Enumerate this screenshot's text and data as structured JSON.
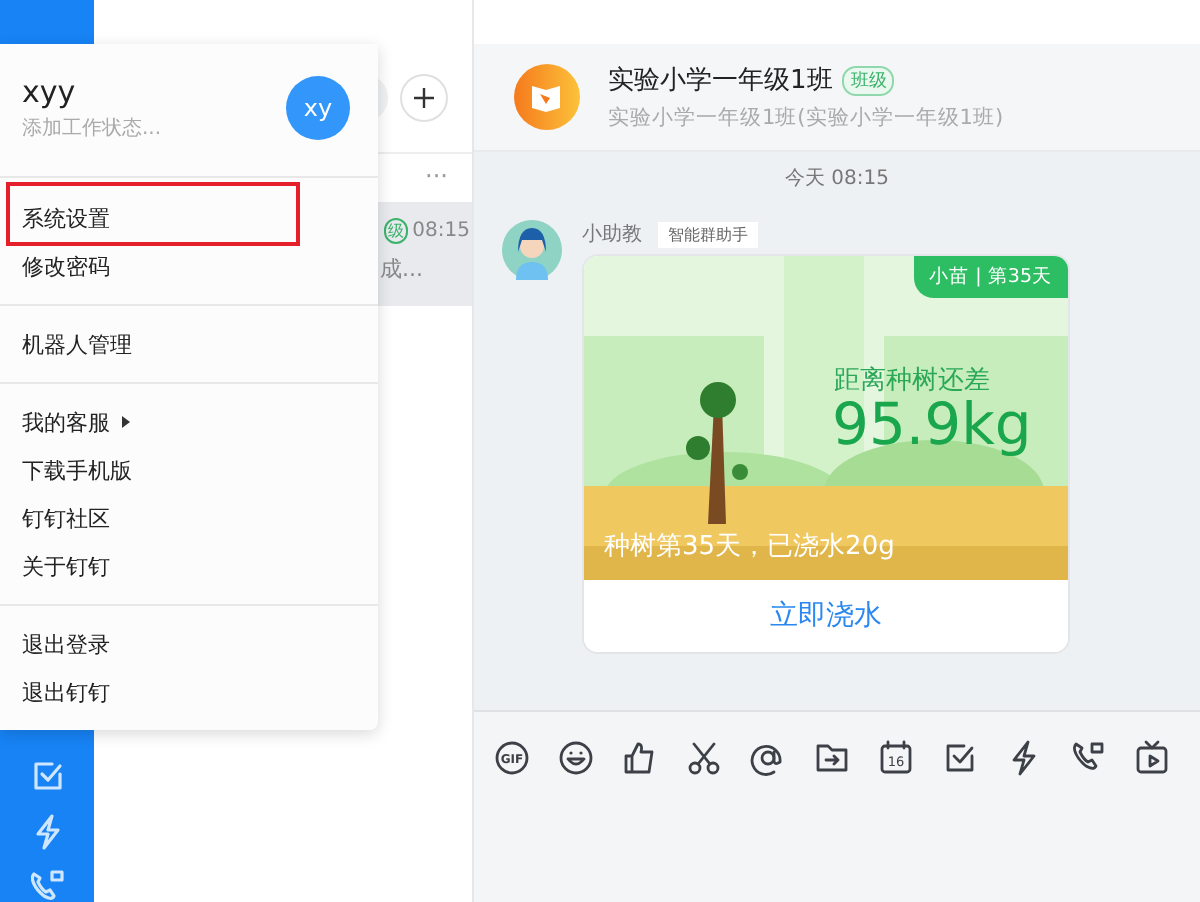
{
  "profile": {
    "name": "xyy",
    "status": "添加工作状态...",
    "avatar": "xy"
  },
  "menu_groups": [
    [
      {
        "label": "系统设置",
        "highlighted": true,
        "submenu": false
      },
      {
        "label": "修改密码",
        "highlighted": false,
        "submenu": false
      }
    ],
    [
      {
        "label": "机器人管理",
        "highlighted": false,
        "submenu": false
      }
    ],
    [
      {
        "label": "我的客服",
        "highlighted": false,
        "submenu": true
      },
      {
        "label": "下载手机版",
        "highlighted": false,
        "submenu": false
      },
      {
        "label": "钉钉社区",
        "highlighted": false,
        "submenu": false
      },
      {
        "label": "关于钉钉",
        "highlighted": false,
        "submenu": false
      }
    ],
    [
      {
        "label": "退出登录",
        "highlighted": false,
        "submenu": false
      },
      {
        "label": "退出钉钉",
        "highlighted": false,
        "submenu": false
      }
    ]
  ],
  "chat_list": {
    "more": "···",
    "rows": [
      {
        "tag": "级",
        "time": "08:15",
        "preview": "成...",
        "selected": true
      }
    ]
  },
  "chat": {
    "title": "实验小学一年级1班",
    "tag": "班级",
    "subtitle": "实验小学一年级1班(实验小学一年级1班)",
    "time_divider": "今天 08:15",
    "message": {
      "sender": "小助教",
      "sender_tag": "智能群助手",
      "card": {
        "badge": "小苗 | 第35天",
        "caption": "距离种树还差",
        "amount": "95.9kg",
        "footer": "种树第35天，已浇水20g",
        "action": "立即浇水"
      }
    },
    "toolbar": [
      {
        "kind": "gif",
        "label": "GIF"
      },
      {
        "kind": "emoji"
      },
      {
        "kind": "like"
      },
      {
        "kind": "scissors"
      },
      {
        "kind": "at"
      },
      {
        "kind": "folder"
      },
      {
        "kind": "calendar",
        "label": "16"
      },
      {
        "kind": "task"
      },
      {
        "kind": "bolt"
      },
      {
        "kind": "call"
      },
      {
        "kind": "live"
      }
    ]
  }
}
